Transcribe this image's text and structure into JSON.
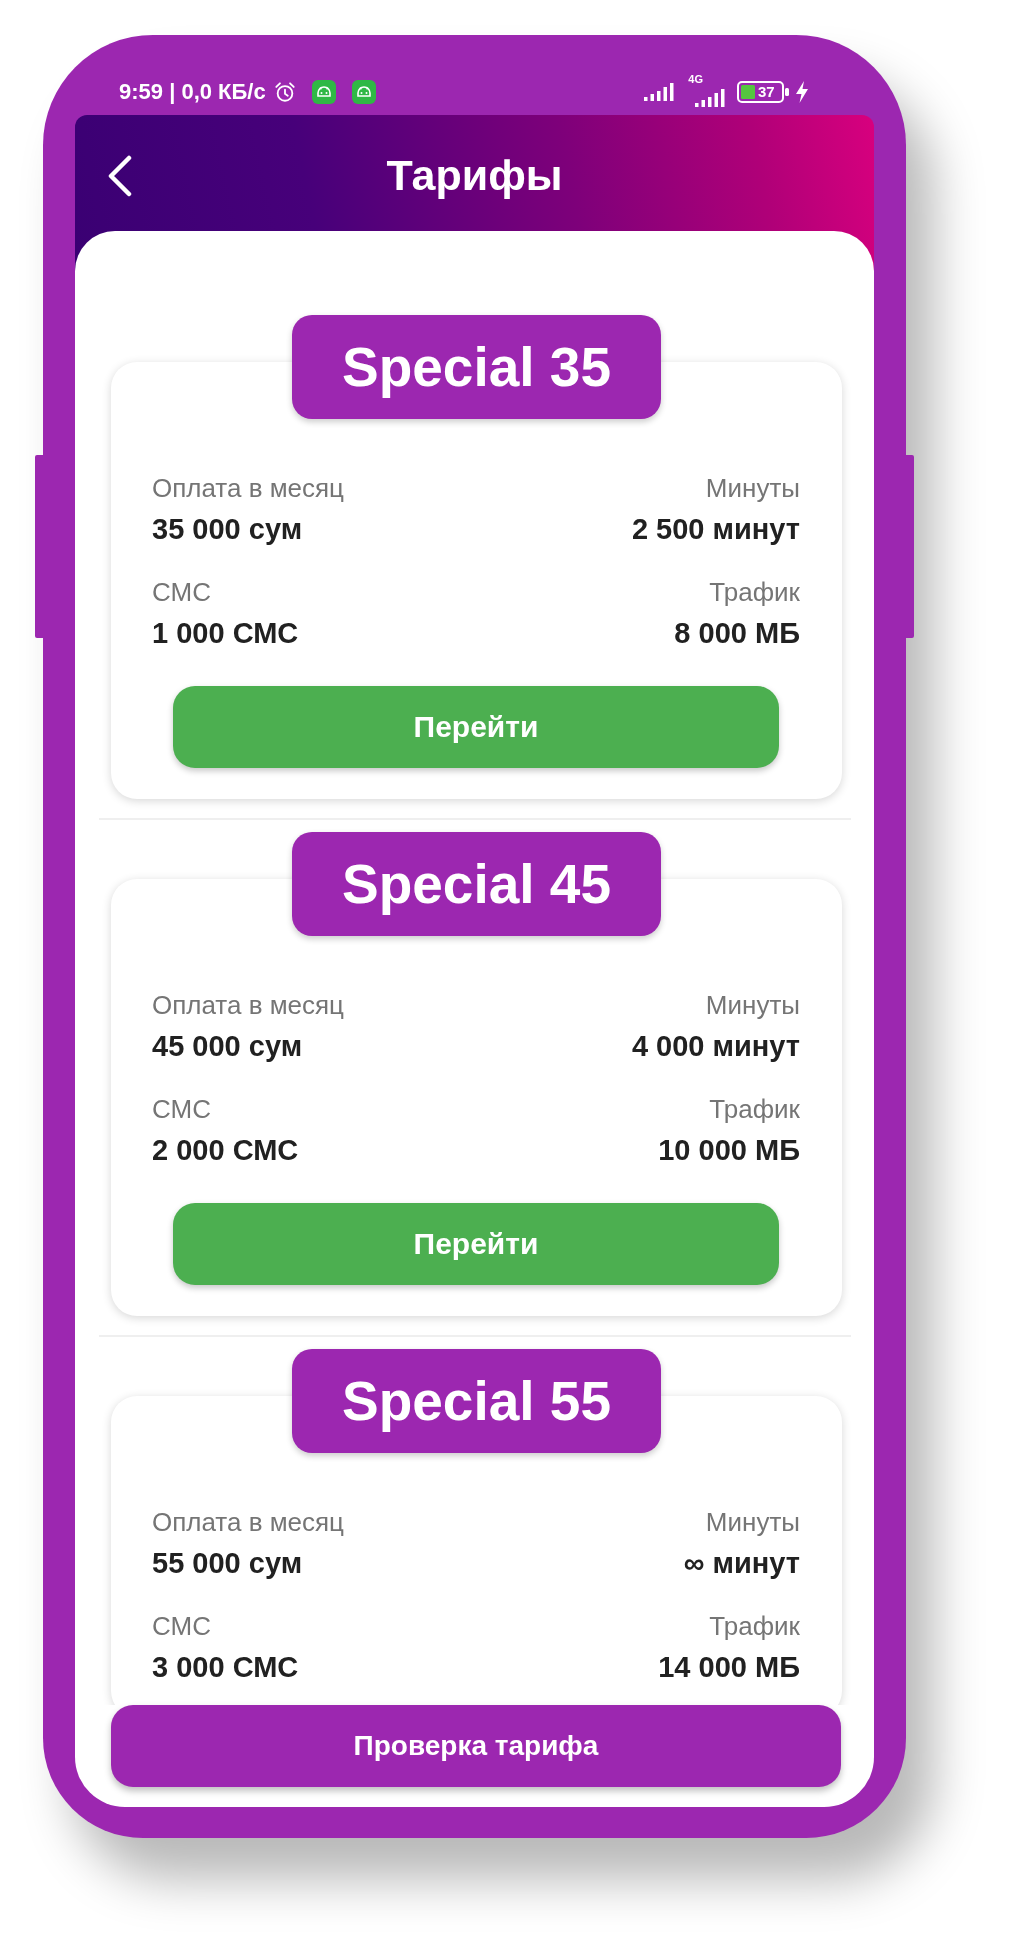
{
  "status_bar": {
    "time_and_speed": "9:59 | 0,0 КБ/с",
    "network_type": "4G",
    "battery": "37"
  },
  "header": {
    "title": "Тарифы"
  },
  "tariffs": [
    {
      "name": "Special 35",
      "fields": [
        {
          "label": "Оплата в месяц",
          "value": "35 000 сум"
        },
        {
          "label": "Минуты",
          "value": "2 500 минут"
        },
        {
          "label": "СМС",
          "value": "1 000 СМС"
        },
        {
          "label": "Трафик",
          "value": "8 000 МБ"
        }
      ],
      "button": "Перейти"
    },
    {
      "name": "Special 45",
      "fields": [
        {
          "label": "Оплата в месяц",
          "value": "45 000 сум"
        },
        {
          "label": "Минуты",
          "value": "4 000 минут"
        },
        {
          "label": "СМС",
          "value": "2 000 СМС"
        },
        {
          "label": "Трафик",
          "value": "10 000 МБ"
        }
      ],
      "button": "Перейти"
    },
    {
      "name": "Special 55",
      "fields": [
        {
          "label": "Оплата в месяц",
          "value": "55 000 сум"
        },
        {
          "label": "Минуты",
          "value": "∞ минут"
        },
        {
          "label": "СМС",
          "value": "3 000 СМС"
        },
        {
          "label": "Трафик",
          "value": "14 000 МБ"
        }
      ]
    }
  ],
  "bottom_button": {
    "label": "Проверка тарифа"
  }
}
